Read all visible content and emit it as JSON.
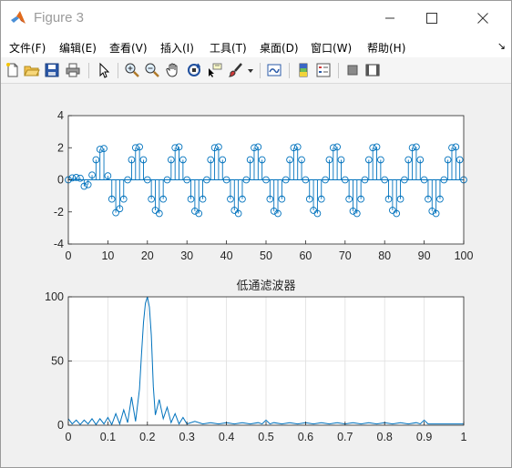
{
  "window": {
    "title": "Figure 3",
    "controls": {
      "minimize": "minimize",
      "maximize": "maximize",
      "close": "close"
    }
  },
  "menu": {
    "items": [
      {
        "label": "文件(F)",
        "name": "menu-file"
      },
      {
        "label": "编辑(E)",
        "name": "menu-edit"
      },
      {
        "label": "查看(V)",
        "name": "menu-view"
      },
      {
        "label": "插入(I)",
        "name": "menu-insert"
      },
      {
        "label": "工具(T)",
        "name": "menu-tools"
      },
      {
        "label": "桌面(D)",
        "name": "menu-desktop"
      },
      {
        "label": "窗口(W)",
        "name": "menu-window"
      },
      {
        "label": "帮助(H)",
        "name": "menu-help"
      }
    ],
    "overflow_arrow": "↘"
  },
  "toolbar": {
    "buttons": [
      "new-figure-icon",
      "open-file-icon",
      "save-icon",
      "print-icon",
      "select-pointer-icon",
      "zoom-in-icon",
      "zoom-out-icon",
      "pan-hand-icon",
      "rotate-3d-icon",
      "data-cursor-icon",
      "brush-icon",
      "brush-dropdown-icon",
      "link-plot-icon",
      "insert-colorbar-icon",
      "insert-legend-icon",
      "hide-plot-tools-icon",
      "show-plot-tools-icon"
    ]
  },
  "colors": {
    "series": "#0072bd",
    "grid": "#dfdfdf",
    "axes": "#262626"
  },
  "chart_data": [
    {
      "type": "stem",
      "title": "",
      "xlabel": "",
      "ylabel": "",
      "xlim": [
        0,
        100
      ],
      "ylim": [
        -4,
        4
      ],
      "xticks": [
        0,
        10,
        20,
        30,
        40,
        50,
        60,
        70,
        80,
        90,
        100
      ],
      "yticks": [
        -4,
        -2,
        0,
        2,
        4
      ],
      "grid": false,
      "series": [
        {
          "marker": "circle",
          "x": [
            0,
            1,
            2,
            3,
            4,
            5,
            6,
            7,
            8,
            9,
            10,
            11,
            12,
            13,
            14,
            15,
            16,
            17,
            18,
            19,
            20,
            21,
            22,
            23,
            24,
            25,
            26,
            27,
            28,
            29,
            30,
            31,
            32,
            33,
            34,
            35,
            36,
            37,
            38,
            39,
            40,
            41,
            42,
            43,
            44,
            45,
            46,
            47,
            48,
            49,
            50,
            51,
            52,
            53,
            54,
            55,
            56,
            57,
            58,
            59,
            60,
            61,
            62,
            63,
            64,
            65,
            66,
            67,
            68,
            69,
            70,
            71,
            72,
            73,
            74,
            75,
            76,
            77,
            78,
            79,
            80,
            81,
            82,
            83,
            84,
            85,
            86,
            87,
            88,
            89,
            90,
            91,
            92,
            93,
            94,
            95,
            96,
            97,
            98,
            99,
            100
          ],
          "y": [
            0.0,
            0.12,
            0.15,
            0.1,
            -0.4,
            -0.3,
            0.3,
            1.25,
            1.9,
            1.95,
            0.25,
            -1.2,
            -2.05,
            -1.8,
            -1.2,
            0.0,
            1.25,
            2.0,
            2.05,
            1.25,
            0.0,
            -1.2,
            -1.9,
            -2.1,
            -1.2,
            0.0,
            1.25,
            2.0,
            2.05,
            1.25,
            0.0,
            -1.2,
            -1.95,
            -2.1,
            -1.2,
            0.0,
            1.25,
            2.0,
            2.05,
            1.25,
            0.0,
            -1.2,
            -1.9,
            -2.1,
            -1.2,
            0.0,
            1.25,
            2.0,
            2.05,
            1.25,
            0.0,
            -1.2,
            -1.95,
            -2.1,
            -1.2,
            0.0,
            1.25,
            2.0,
            2.05,
            1.25,
            0.0,
            -1.2,
            -1.9,
            -2.1,
            -1.2,
            0.0,
            1.25,
            2.0,
            2.05,
            1.25,
            0.0,
            -1.2,
            -1.95,
            -2.1,
            -1.2,
            0.0,
            1.25,
            2.0,
            2.05,
            1.25,
            0.0,
            -1.2,
            -1.9,
            -2.1,
            -1.2,
            0.0,
            1.25,
            2.0,
            2.05,
            1.25,
            0.0,
            -1.2,
            -1.95,
            -2.1,
            -1.2,
            0.0,
            1.25,
            2.0,
            2.05,
            1.25,
            0.0
          ]
        }
      ]
    },
    {
      "type": "line",
      "title": "低通滤波器",
      "xlabel": "",
      "ylabel": "",
      "xlim": [
        0,
        1
      ],
      "ylim": [
        0,
        100
      ],
      "xticks": [
        0,
        0.1,
        0.2,
        0.3,
        0.4,
        0.5,
        0.6,
        0.7,
        0.8,
        0.9,
        1
      ],
      "yticks": [
        0,
        50,
        100
      ],
      "grid": true,
      "series": [
        {
          "x": [
            0,
            0.01,
            0.02,
            0.03,
            0.04,
            0.05,
            0.06,
            0.07,
            0.08,
            0.09,
            0.1,
            0.11,
            0.12,
            0.13,
            0.14,
            0.15,
            0.16,
            0.17,
            0.18,
            0.185,
            0.19,
            0.195,
            0.2,
            0.205,
            0.21,
            0.215,
            0.22,
            0.23,
            0.24,
            0.25,
            0.26,
            0.27,
            0.28,
            0.29,
            0.3,
            0.32,
            0.34,
            0.36,
            0.38,
            0.4,
            0.42,
            0.44,
            0.46,
            0.48,
            0.49,
            0.5,
            0.51,
            0.52,
            0.54,
            0.56,
            0.58,
            0.6,
            0.62,
            0.64,
            0.66,
            0.68,
            0.7,
            0.72,
            0.74,
            0.76,
            0.78,
            0.8,
            0.82,
            0.84,
            0.86,
            0.88,
            0.89,
            0.9,
            0.91,
            0.92,
            0.94,
            0.96,
            0.98,
            1.0
          ],
          "y": [
            5,
            1,
            4,
            0.5,
            4,
            1,
            5,
            0.5,
            5,
            1,
            6,
            0.5,
            9,
            1,
            12,
            2,
            22,
            3,
            28,
            55,
            80,
            95,
            100,
            92,
            70,
            30,
            8,
            20,
            5,
            14,
            2,
            9,
            1,
            6,
            1,
            3,
            1,
            2,
            1,
            2,
            1,
            2,
            1,
            2,
            1,
            4,
            1,
            2,
            1,
            2,
            1,
            2,
            1,
            2,
            1,
            2,
            1,
            2,
            1,
            2,
            1,
            2,
            1,
            2,
            1,
            2,
            1,
            4,
            1,
            1,
            1,
            1,
            1,
            1
          ]
        }
      ]
    }
  ]
}
